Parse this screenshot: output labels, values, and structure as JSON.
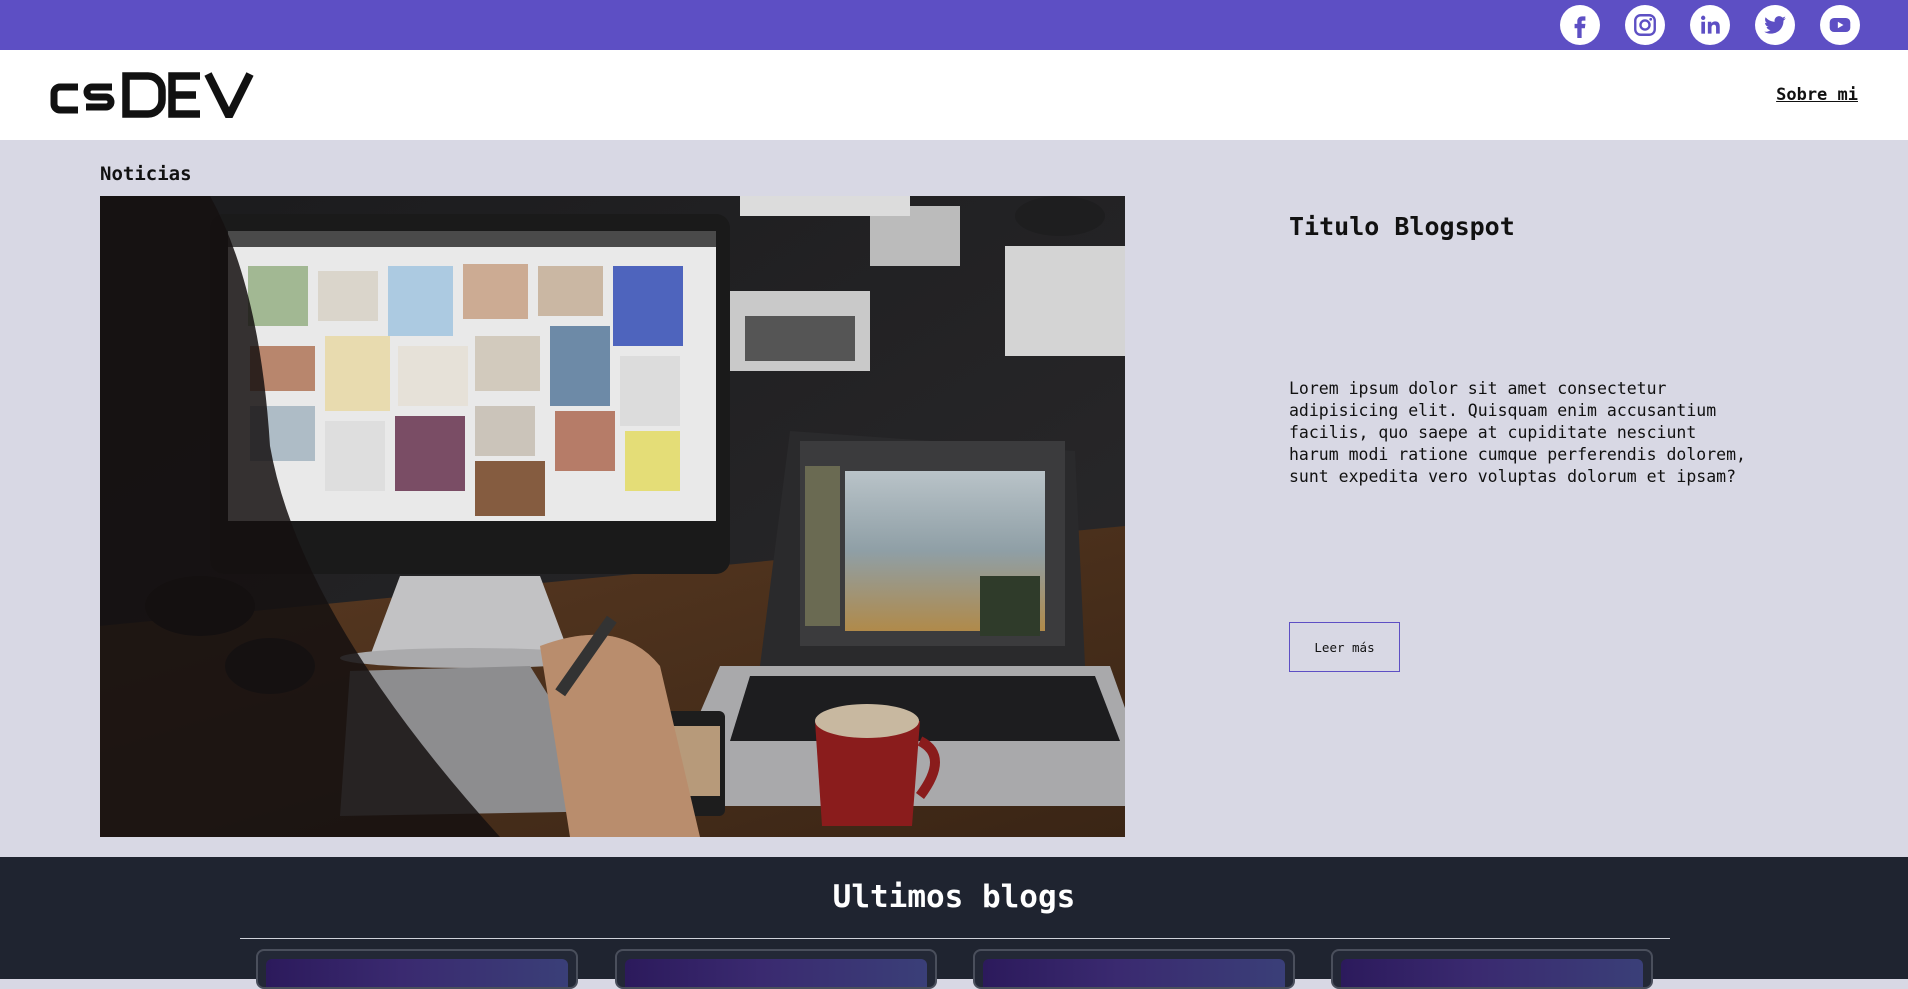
{
  "topbar": {
    "bg_color": "#5d4fc4",
    "social_icons": [
      "facebook-icon",
      "instagram-icon",
      "linkedin-icon",
      "twitter-icon",
      "youtube-icon"
    ]
  },
  "navbar": {
    "logo_text": "csDEV",
    "link": "Sobre mi"
  },
  "news": {
    "section_label": "Noticias",
    "post": {
      "title": "Titulo Blogspot",
      "excerpt": "Lorem ipsum dolor sit amet consectetur adipisicing elit. Quisquam enim accusantium facilis, quo saepe at cupiditate nesciunt harum modi ratione cumque perferendis dolorem, sunt expedita vero voluptas dolorum et ipsam?",
      "button_label": "Leer más"
    }
  },
  "blogs": {
    "title": "Ultimos blogs",
    "card_count": 4
  }
}
